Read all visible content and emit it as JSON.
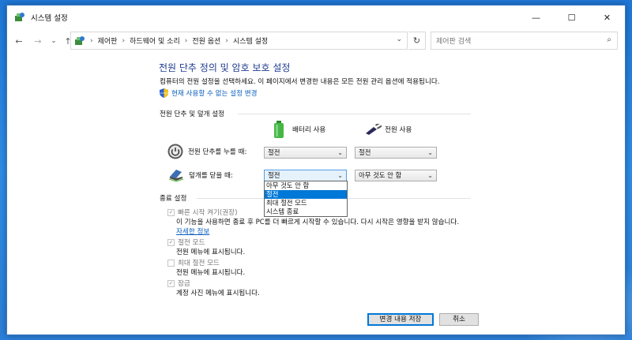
{
  "window": {
    "title": "시스템 설정"
  },
  "nav": {
    "back": "←",
    "forward": "→",
    "recent": "⌄",
    "up": "↑",
    "breadcrumbs": [
      "제어판",
      "하드웨어 및 소리",
      "전원 옵션",
      "시스템 설정"
    ],
    "search_placeholder": "제어판 검색"
  },
  "page": {
    "title": "전원 단추 정의 및 암호 보호 설정",
    "description": "컴퓨터의 전원 설정을 선택하세요. 이 페이지에서 변경한 내용은 모든 전원 관리 옵션에 적용됩니다.",
    "admin_link": "현재 사용할 수 없는 설정 변경"
  },
  "power_section": {
    "title": "전원 단추 및 덮개 설정",
    "col_battery": "배터리 사용",
    "col_plugged": "전원 사용",
    "rows": [
      {
        "label": "전원 단추를 누를 때:",
        "battery": "절전",
        "plugged": "절전"
      },
      {
        "label": "덮개를 닫을 때:",
        "battery": "절전",
        "plugged": "아무 것도 안 함"
      }
    ],
    "dropdown_options": [
      "아무 것도 안 함",
      "절전",
      "최대 절전 모드",
      "시스템 종료"
    ],
    "dropdown_selected": "절전"
  },
  "shutdown_section": {
    "title": "종료 설정",
    "items": [
      {
        "label": "빠른 시작 켜기(권장)",
        "checked": true,
        "desc": "이 기능을 사용하면 종료 후 PC를 더 빠르게 시작할 수 있습니다. 다시 시작은 영향을 받지 않습니다.",
        "link": "자세한 정보"
      },
      {
        "label": "절전 모드",
        "checked": true,
        "desc": "전원 메뉴에 표시됩니다."
      },
      {
        "label": "최대 절전 모드",
        "checked": false,
        "desc": "전원 메뉴에 표시됩니다."
      },
      {
        "label": "잠금",
        "checked": true,
        "desc": "계정 사진 메뉴에 표시됩니다."
      }
    ]
  },
  "footer": {
    "save": "변경 내용 저장",
    "cancel": "취소"
  },
  "colors": {
    "accent": "#0078d7",
    "title_blue": "#1e3b8f",
    "link": "#0a5fbf"
  }
}
